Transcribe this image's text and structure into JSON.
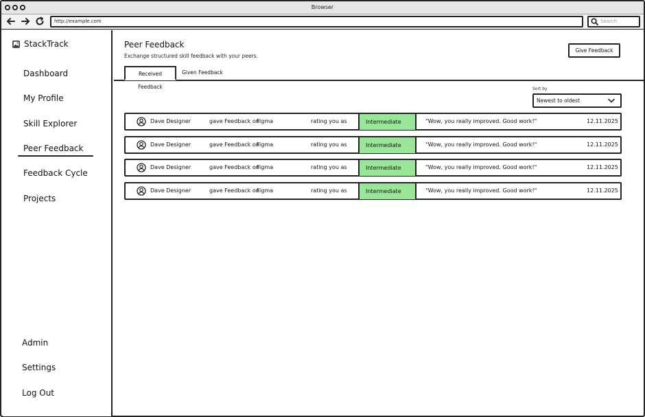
{
  "browser": {
    "title": "Browser",
    "url": "http://example.com",
    "search_placeholder": "Search"
  },
  "sidebar": {
    "brand": "StackTrack",
    "items": [
      {
        "label": "Dashboard"
      },
      {
        "label": "My Profile"
      },
      {
        "label": "Skill Explorer"
      },
      {
        "label": "Peer Feedback"
      },
      {
        "label": "Feedback Cycle"
      },
      {
        "label": "Projects"
      }
    ],
    "active_item": "Peer Feedback",
    "bottom_items": [
      {
        "label": "Admin"
      },
      {
        "label": "Settings"
      },
      {
        "label": "Log Out"
      }
    ]
  },
  "main": {
    "title": "Peer Feedback",
    "subtitle": "Exchange structured skill feedback with your peers.",
    "give_button": "Give Feedback",
    "tabs": [
      {
        "label": "Received Feedback",
        "active": true
      },
      {
        "label": "Given Feedback",
        "active": false
      }
    ],
    "sort": {
      "label": "Sort by",
      "value": "Newest to oldest"
    },
    "rows": [
      {
        "name": "Dave Designer",
        "verb": "gave Feedback on",
        "skill": "Figma",
        "rating_text": "rating you as",
        "level": "Intermediate",
        "comment": "\"Wow, you really improved. Good work!\"",
        "date": "12.11.2025"
      },
      {
        "name": "Dave Designer",
        "verb": "gave Feedback on",
        "skill": "Figma",
        "rating_text": "rating you as",
        "level": "Intermediate",
        "comment": "\"Wow, you really improved. Good work!\"",
        "date": "12.11.2025"
      },
      {
        "name": "Dave Designer",
        "verb": "gave Feedback on",
        "skill": "Figma",
        "rating_text": "rating you as",
        "level": "Intermediate",
        "comment": "\"Wow, you really improved. Good work!\"",
        "date": "12.11.2025"
      },
      {
        "name": "Dave Designer",
        "verb": "gave Feedback on",
        "skill": "Figma",
        "rating_text": "rating you as",
        "level": "Intermediate",
        "comment": "\"Wow, you really improved. Good work!\"",
        "date": "12.11.2025"
      }
    ]
  },
  "colors": {
    "level_badge": "#99e699",
    "border": "#222222"
  },
  "icons": {
    "logo": "image-icon",
    "avatar": "user-circle-icon",
    "search": "search-icon",
    "sort_chevron": "chevron-down-icon"
  }
}
